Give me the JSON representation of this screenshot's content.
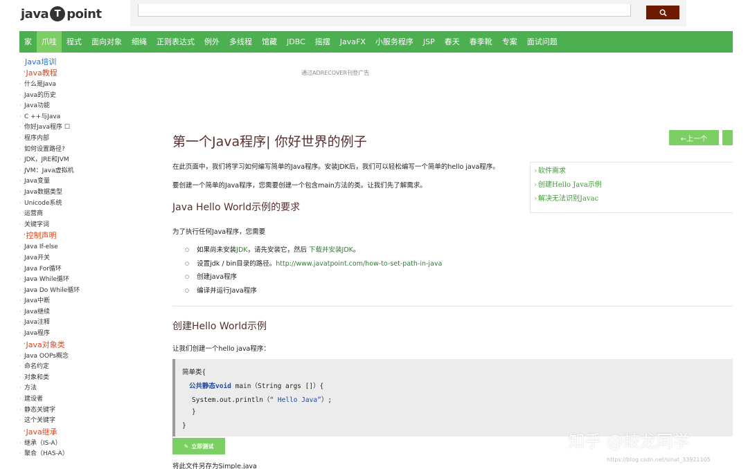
{
  "header": {
    "logo_left": "java",
    "logo_badge": "T",
    "logo_right": "point",
    "search_value": ""
  },
  "nav": [
    "家",
    "爪哇",
    "程式",
    "面向对象",
    "细绳",
    "正则表达式",
    "例外",
    "多线程",
    "馆藏",
    "JDBC",
    "摇摆",
    "JavaFX",
    "小服务程序",
    "JSP",
    "春天",
    "春季靴",
    "专案",
    "面试问题"
  ],
  "sidebar": {
    "top_link": "Java培训",
    "sections": [
      {
        "title": "Java教程",
        "items": [
          "什么是Java",
          "Java的历史",
          "Java功能",
          "C ++与Java",
          "你好Java程序 ☐",
          "程序内部",
          "如何设置路径?",
          "JDK，JRE和JVM",
          "JVM：Java虚拟机",
          "Java变量",
          "Java数据类型",
          "Unicode系统",
          "运营商",
          "关键字词"
        ]
      },
      {
        "title": "控制声明",
        "items": [
          "Java If-else",
          "Java开关",
          "Java For循环",
          "Java While循环",
          "Java Do While循环",
          "Java中断",
          "Java继续",
          "Java注释",
          "Java程序"
        ]
      },
      {
        "title": "Java对象类",
        "items": [
          "Java OOPs概念",
          "命名约定",
          "对象和类",
          "方法",
          "建设者",
          "静态关键字",
          "这个关键字"
        ]
      },
      {
        "title": "Java继承",
        "items": [
          "继承（IS-A）",
          "聚合（HAS-A）"
        ]
      }
    ]
  },
  "content": {
    "ad_text": "通过ADRECOVER刊登广告",
    "title": "第一个Java程序| 你好世界的例子",
    "prev_label": "←上一个",
    "intro1": "在此页面中，我们将学习如何编写简单的Java程序。安装JDK后，我们可以轻松编写一个简单的hello java程序。",
    "intro2": "要创建一个简单的Java程序，您需要创建一个包含main方法的类。让我们先了解需求。",
    "toc": [
      "软件需求",
      "创建Hello Java示例",
      "解决无法识别Javac"
    ],
    "h2_requirements": "Java Hello World示例的要求",
    "req_intro": "为了执行任何Java程序，您需要",
    "req_items": [
      {
        "pre": "如果尚未安装",
        "link1": "JDK",
        "mid": "，请先安装它，然后 ",
        "link2": "下载并安装JDK",
        "post": "。"
      },
      {
        "pre": "设置jdk / bin目录的路径。",
        "link1": "http://www.javatpoint.com/how-to-set-path-in-java",
        "mid": "",
        "link2": "",
        "post": ""
      },
      {
        "pre": "创建java程序",
        "link1": "",
        "mid": "",
        "link2": "",
        "post": ""
      },
      {
        "pre": "编译并运行Java程序",
        "link1": "",
        "mid": "",
        "link2": "",
        "post": ""
      }
    ],
    "h2_create": "创建Hello World示例",
    "create_intro": "让我们创建一个hello java程序：",
    "code": {
      "line1": "简单类{",
      "line2_kw": "公共静态void",
      "line2_rest": " main（String args []）{",
      "line3_a": "System.out.println（",
      "line3_str": "“ Hello Java”",
      "line3_b": "）;",
      "line4": "}",
      "line5": "}"
    },
    "try_label": "立即测试",
    "save_text": "将此文件另存为Simple.java"
  },
  "watermark": {
    "main": "知乎 @蛟龙同学",
    "url": "https://blog.csdn.net/sinat_33921105"
  },
  "colors": {
    "nav_green": "#4caf50",
    "button_green": "#7ccf62",
    "search_button": "#6e1a00",
    "heading": "#5a2e2e",
    "sidebar_heading": "#e0461e",
    "link_green": "#2e7d32"
  }
}
